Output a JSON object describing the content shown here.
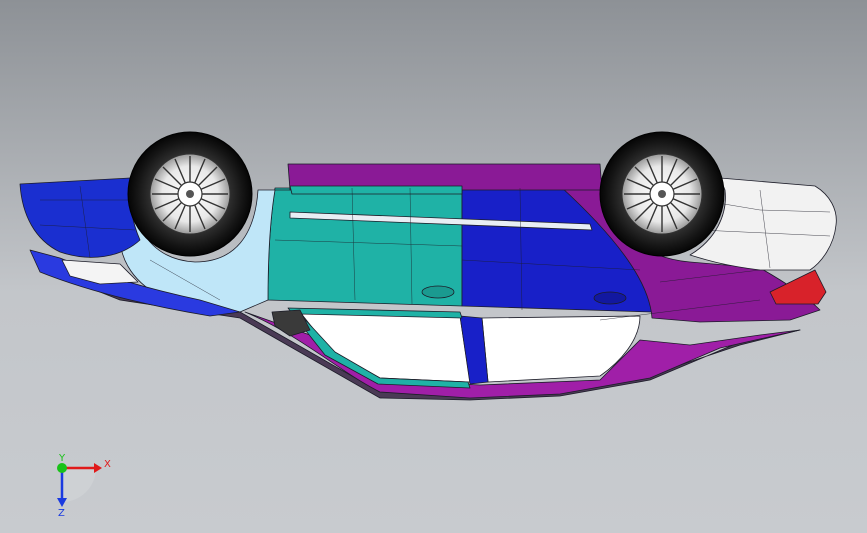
{
  "viewport": {
    "background_top": "#8d9196",
    "background_mid": "#c3c6ca",
    "background_bottom": "#c8cbcf"
  },
  "model": {
    "name": "car-body-upside-down",
    "panel_colors": {
      "front_bumper": "#1a2fd0",
      "front_fender": "#bfe6f8",
      "front_door": "#1fb2a6",
      "rear_door": "#1820c8",
      "rear_quarter": "#8a1a96",
      "rear_bumper": "#f2f2f2",
      "roof": "#a01fa8",
      "window": "#ffffff",
      "tire": "#222222",
      "tail_light": "#d8222a"
    }
  },
  "triad": {
    "x_label": "X",
    "y_label": "Y",
    "z_label": "Z",
    "x_color": "#e01a1a",
    "y_color": "#19c219",
    "z_color": "#1a3ae0"
  }
}
